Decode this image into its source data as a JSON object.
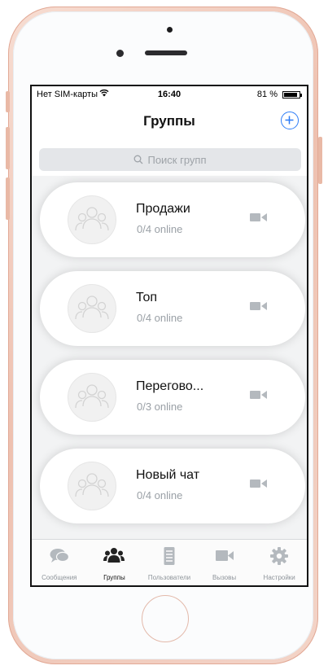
{
  "statusbar": {
    "carrier": "Нет SIM-карты",
    "time": "16:40",
    "battery": "81 %"
  },
  "navbar": {
    "title": "Группы",
    "add_icon": "plus-circle-icon"
  },
  "search": {
    "placeholder": "Поиск групп"
  },
  "groups": [
    {
      "name": "Продажи",
      "status": "0/4 online"
    },
    {
      "name": "Топ",
      "status": "0/4 online"
    },
    {
      "name": "Перегово...",
      "status": "0/3 online"
    },
    {
      "name": "Новый чат",
      "status": "0/4 online"
    }
  ],
  "tabs": [
    {
      "label": "Сообщения",
      "icon": "chat-bubbles-icon",
      "active": false
    },
    {
      "label": "Группы",
      "icon": "group-icon",
      "active": true
    },
    {
      "label": "Пользователи",
      "icon": "document-list-icon",
      "active": false
    },
    {
      "label": "Вызовы",
      "icon": "video-camera-icon",
      "active": false
    },
    {
      "label": "Настройки",
      "icon": "gear-icon",
      "active": false
    }
  ],
  "colors": {
    "accent": "#2d7cf6",
    "icon_gray": "#b4b9be",
    "active_tab": "#222222",
    "frame": "#eec1b0"
  }
}
